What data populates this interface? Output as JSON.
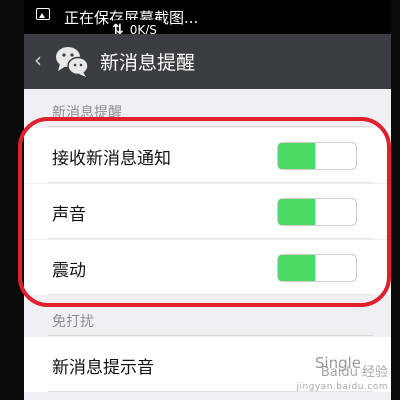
{
  "status_bar": {
    "notification_text": "正在保存屏幕截图...",
    "net_speed": "0K/S",
    "screenshot_icon": "image-icon",
    "sync_icon": "sync-icon"
  },
  "title_bar": {
    "back_icon": "chevron-left-icon",
    "app_icon": "wechat-icon",
    "title": "新消息提醒"
  },
  "sections": [
    {
      "header": "新消息提醒",
      "items": [
        {
          "label": "接收新消息通知",
          "type": "toggle",
          "on": true
        },
        {
          "label": "声音",
          "type": "toggle",
          "on": true
        },
        {
          "label": "震动",
          "type": "toggle",
          "on": true
        }
      ]
    },
    {
      "header": "免打扰",
      "items": [
        {
          "label": "新消息提示音",
          "type": "value",
          "value": "Single"
        }
      ]
    }
  ],
  "watermark": {
    "line1": "Baidu 经验",
    "line2": "jingyan.baidu.com"
  },
  "colors": {
    "toggle_on": "#4cd964",
    "highlight": "#e0202c",
    "title_bar": "#3a3e42"
  }
}
